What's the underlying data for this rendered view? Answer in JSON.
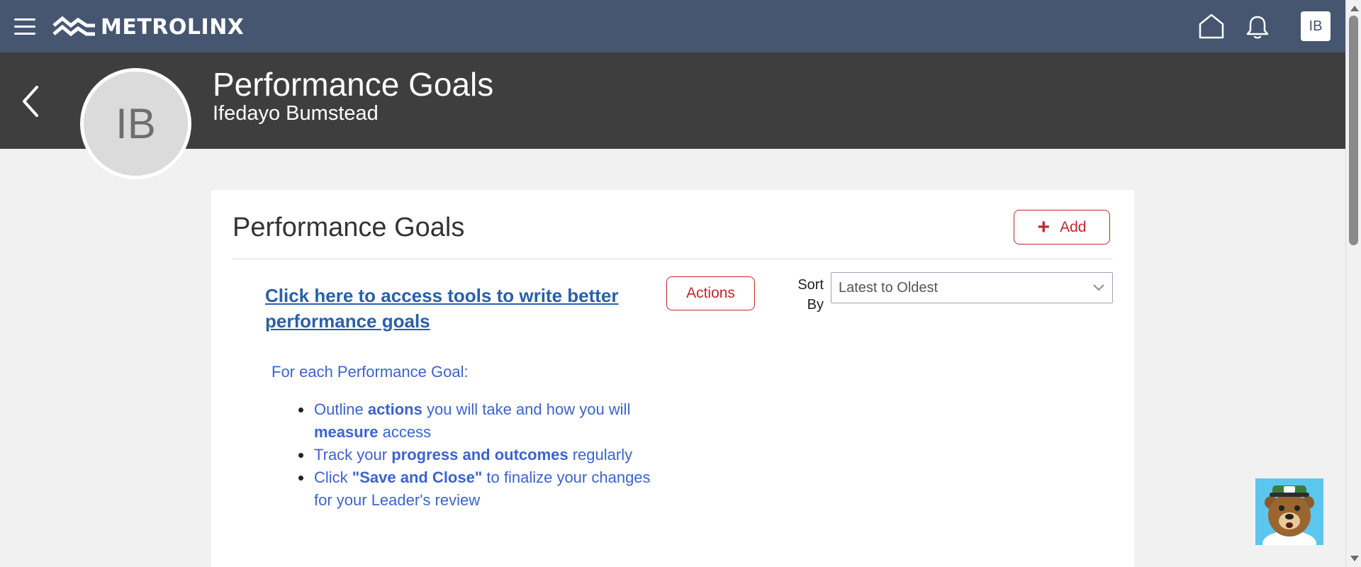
{
  "topbar": {
    "brand": "METROLINX",
    "user_initials": "IB"
  },
  "header": {
    "title": "Performance Goals",
    "subtitle": "Ifedayo Bumstead",
    "avatar_initials": "IB"
  },
  "card": {
    "title": "Performance Goals",
    "add_label": "Add",
    "tools_link": "Click here to access tools to write better performance goals",
    "actions_label": "Actions",
    "sort_label": "Sort By",
    "sort_value": "Latest to Oldest",
    "instructions_heading": "For each Performance Goal:",
    "instructions": [
      {
        "a": "Outline ",
        "b": "actions",
        "c": " you will take and how you will ",
        "d": "measure",
        "e": " access"
      },
      {
        "a": "Track your ",
        "b": "progress and outcomes",
        "c": " regularly"
      },
      {
        "a": "Click ",
        "b": "\"Save and Close\"",
        "c": " to finalize your changes for your Leader's review"
      }
    ]
  },
  "colors": {
    "topbar": "#465671",
    "header": "#3e3e3e",
    "accent_red": "#c0272d",
    "link_blue": "#2b5fa8",
    "instruction_blue": "#3c63cf"
  }
}
